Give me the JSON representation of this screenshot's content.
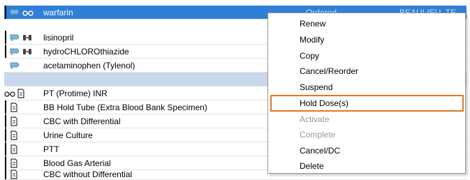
{
  "orders": [
    {
      "name": "warfarin",
      "status": "Ordered",
      "provider": "BEAULIEU, TE",
      "icons": [
        "syringe-icon",
        "glasses-icon"
      ],
      "selected": true
    },
    {
      "name": "lisinopril",
      "icons": [
        "syringe-icon",
        "pill-pair-icon"
      ]
    },
    {
      "name": "hydroCHLOROthiazide",
      "icons": [
        "syringe-icon",
        "pill-pair-icon"
      ]
    },
    {
      "name": "acetaminophen (Tylenol)",
      "icons": [
        "syringe-icon"
      ]
    },
    {
      "name": "",
      "blank": true
    },
    {
      "name": "PT (Protime) INR",
      "icons": [
        "glasses-icon",
        "document-icon"
      ]
    },
    {
      "name": "BB Hold Tube (Extra Blood Bank Specimen)",
      "icons": [
        "document-icon"
      ]
    },
    {
      "name": "CBC with Differential",
      "icons": [
        "document-icon"
      ]
    },
    {
      "name": "Urine Culture",
      "icons": [
        "document-icon"
      ]
    },
    {
      "name": "PTT",
      "icons": [
        "document-icon"
      ]
    },
    {
      "name": "Blood Gas Arterial",
      "icons": [
        "document-icon"
      ]
    },
    {
      "name": "CBC without Differential",
      "icons": [
        "document-icon"
      ]
    }
  ],
  "context_menu": {
    "items": [
      {
        "label": "Renew",
        "enabled": true
      },
      {
        "label": "Modify",
        "enabled": true
      },
      {
        "label": "Copy",
        "enabled": true
      },
      {
        "label": "Cancel/Reorder",
        "enabled": true
      },
      {
        "label": "Suspend",
        "enabled": true
      },
      {
        "label": "Hold Dose(s)",
        "enabled": true,
        "highlighted": true
      },
      {
        "label": "Activate",
        "enabled": false
      },
      {
        "label": "Complete",
        "enabled": false
      },
      {
        "label": "Cancel/DC",
        "enabled": true
      },
      {
        "label": "Delete",
        "enabled": true
      }
    ]
  },
  "colors": {
    "selection": "#2f7fd8",
    "highlight_outline": "#e07a22",
    "disabled_text": "#9a9a9a"
  }
}
